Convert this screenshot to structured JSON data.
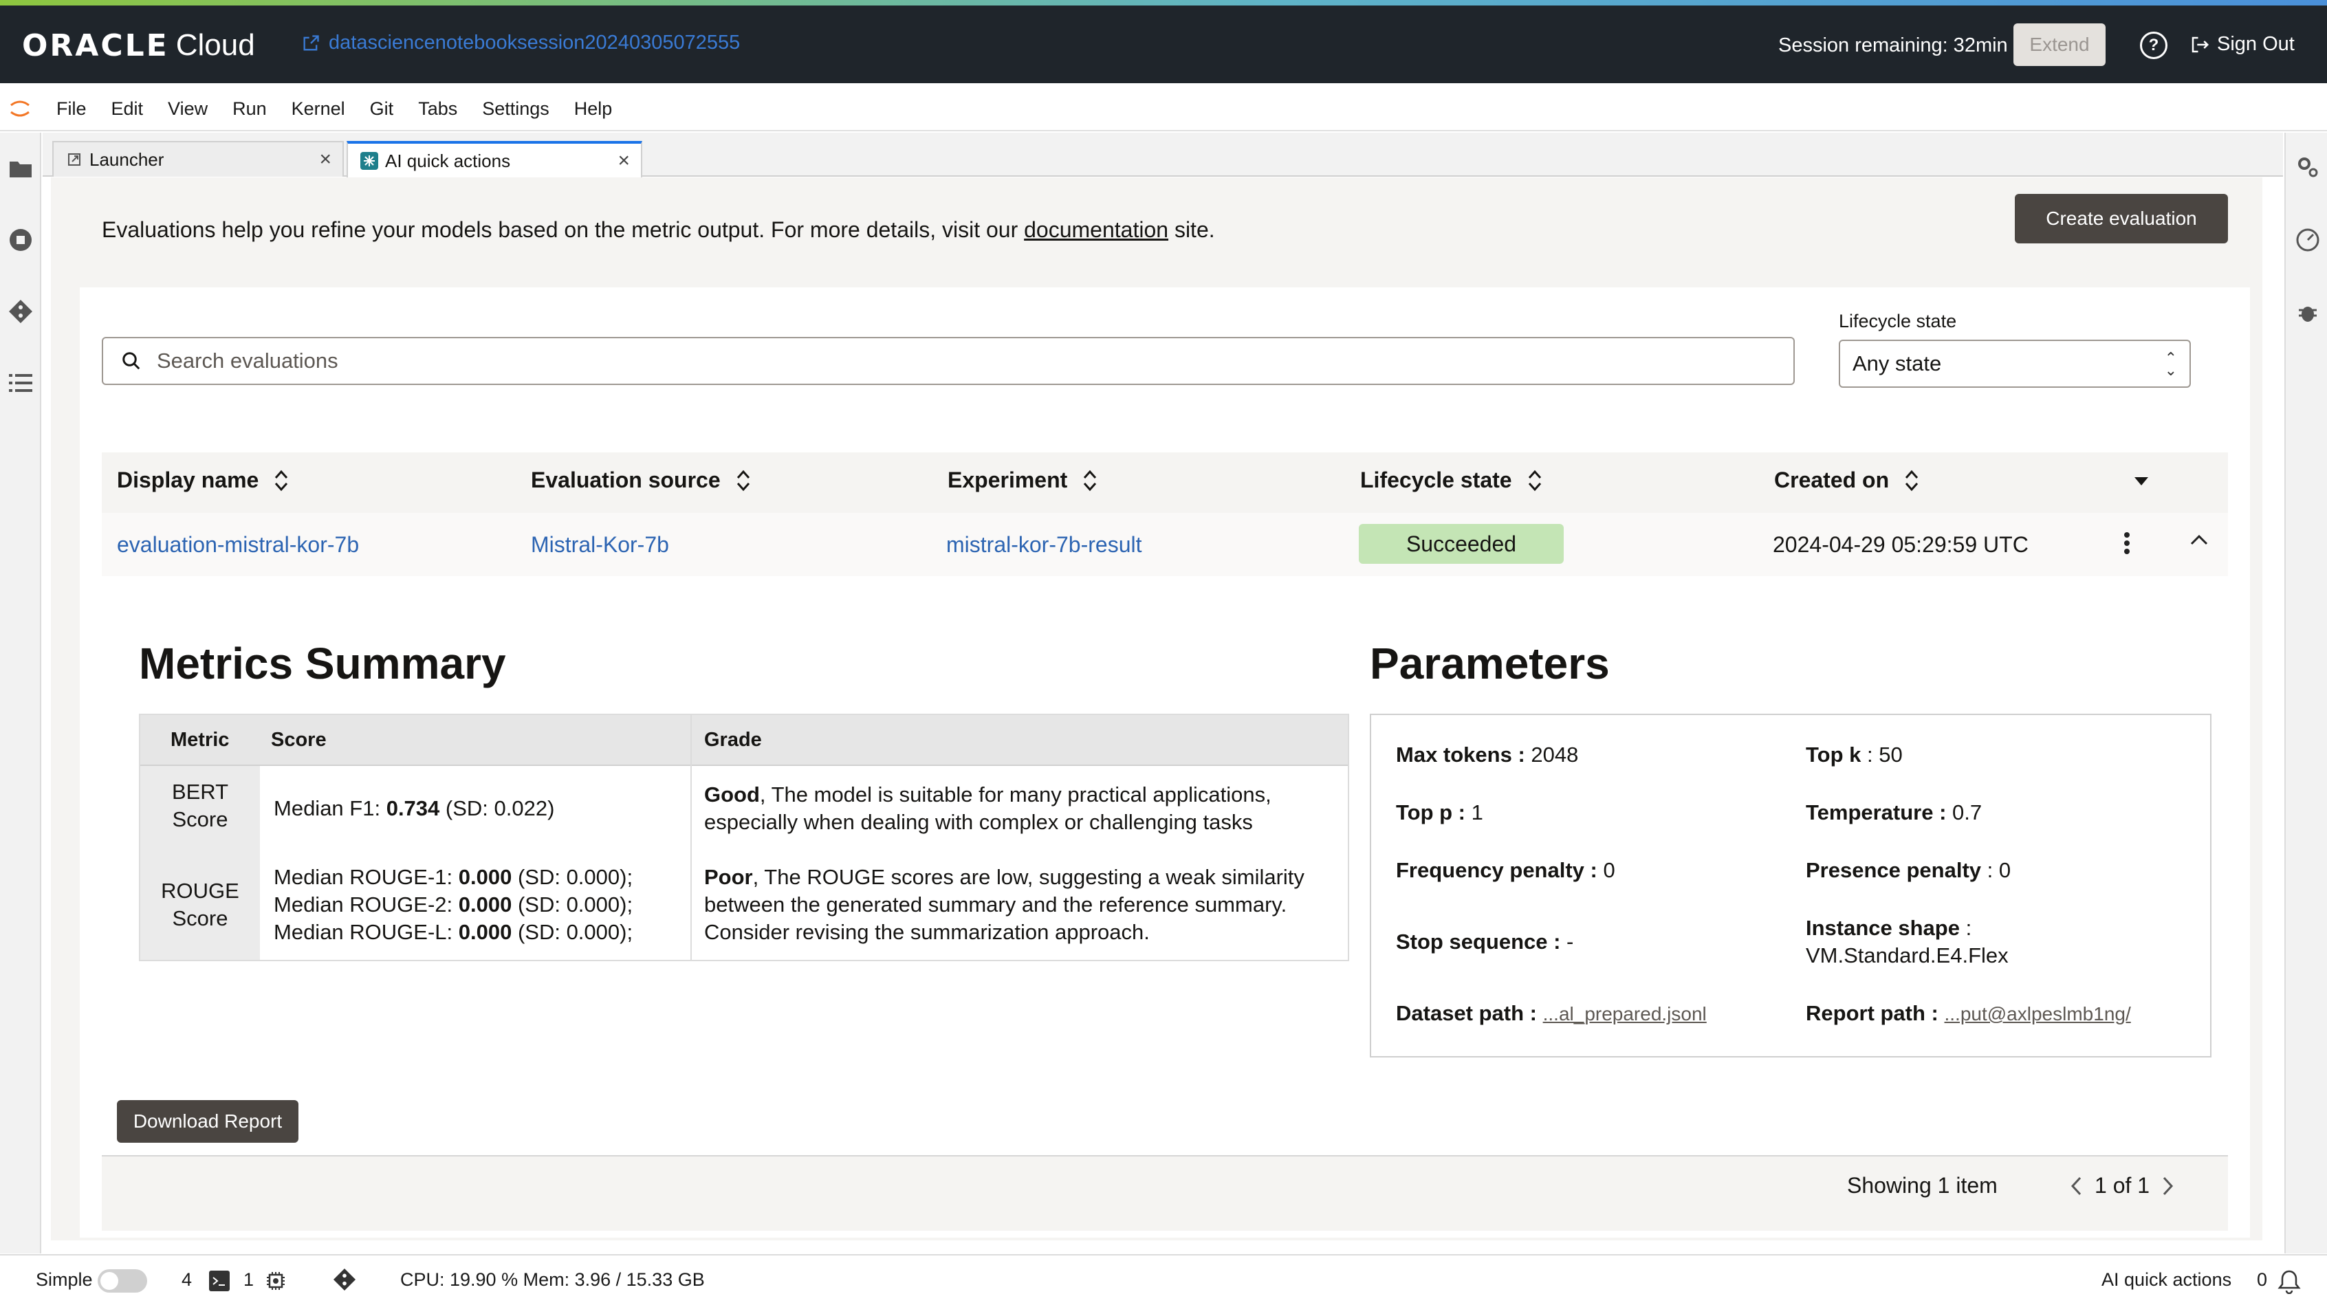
{
  "header": {
    "brand_oracle": "ORACLE",
    "brand_cloud": "Cloud",
    "notebook_link": "datasciencenotebooksession20240305072555",
    "session_remaining": "Session remaining: 32min",
    "extend_label": "Extend",
    "sign_out_label": "Sign Out"
  },
  "menu": [
    "File",
    "Edit",
    "View",
    "Run",
    "Kernel",
    "Git",
    "Tabs",
    "Settings",
    "Help"
  ],
  "tabs": [
    {
      "label": "Launcher",
      "close": "×"
    },
    {
      "label": "AI quick actions",
      "close": "×"
    }
  ],
  "intro": {
    "before": "Evaluations help you refine your models based on the metric output. For more details, visit our ",
    "link": "documentation",
    "after": " site."
  },
  "create_button": "Create evaluation",
  "search": {
    "placeholder": "Search evaluations"
  },
  "lifecycle_filter": {
    "label": "Lifecycle state",
    "value": "Any state"
  },
  "table": {
    "columns": [
      "Display name",
      "Evaluation source",
      "Experiment",
      "Lifecycle state",
      "Created on"
    ],
    "rows": [
      {
        "display_name": "evaluation-mistral-kor-7b",
        "evaluation_source": "Mistral-Kor-7b",
        "experiment": "mistral-kor-7b-result",
        "lifecycle_state": "Succeeded",
        "created_on": "2024-04-29 05:29:59 UTC"
      }
    ]
  },
  "metrics": {
    "title": "Metrics Summary",
    "headers": [
      "Metric",
      "Score",
      "Grade"
    ],
    "rows": [
      {
        "metric_line1": "BERT",
        "metric_line2": "Score",
        "score_prefix": "Median F1: ",
        "score_bold": "0.734",
        "score_suffix": " (SD: 0.022)",
        "grade_bold": "Good",
        "grade_line1": ", The model is suitable for many practical applications,",
        "grade_line2": "especially when dealing with complex or challenging tasks"
      },
      {
        "metric_line1": "ROUGE",
        "metric_line2": "Score",
        "score_lines": [
          {
            "prefix": "Median ROUGE-1: ",
            "bold": "0.000",
            "suffix": " (SD: 0.000);"
          },
          {
            "prefix": "Median ROUGE-2: ",
            "bold": "0.000",
            "suffix": " (SD: 0.000);"
          },
          {
            "prefix": "Median ROUGE-L: ",
            "bold": "0.000",
            "suffix": " (SD: 0.000);"
          }
        ],
        "grade_bold": "Poor",
        "grade_line1": ", The ROUGE scores are low, suggesting a weak similarity",
        "grade_line2": "between the generated summary and the reference summary.",
        "grade_line3": "Consider revising the summarization approach."
      }
    ]
  },
  "parameters": {
    "title": "Parameters",
    "max_tokens": {
      "key": "Max tokens :",
      "value": " 2048"
    },
    "top_k": {
      "key": "Top k",
      "value": " : 50"
    },
    "top_p": {
      "key": "Top p :",
      "value": " 1"
    },
    "temperature": {
      "key": "Temperature :",
      "value": " 0.7"
    },
    "frequency_penalty": {
      "key": "Frequency penalty :",
      "value": " 0"
    },
    "presence_penalty": {
      "key": "Presence penalty",
      "value": " : 0"
    },
    "stop_sequence": {
      "key": "Stop sequence :",
      "value": " -"
    },
    "instance_shape": {
      "key": "Instance shape",
      "value": " :",
      "value2": "VM.Standard.E4.Flex"
    },
    "dataset_path": {
      "key": "Dataset path :",
      "value": "...al_prepared.jsonl"
    },
    "report_path": {
      "key": "Report path :",
      "value": "...put@axlpeslmb1ng/"
    }
  },
  "download_button": "Download Report",
  "footer": {
    "showing": "Showing 1 item",
    "pager": "1 of 1"
  },
  "statusbar": {
    "mode": "Simple",
    "terminals": "4",
    "kernels": "1",
    "resources": "CPU: 19.90 % Mem: 3.96 / 15.33 GB",
    "active_tab": "AI quick actions",
    "notifications": "0"
  },
  "colors": {
    "accent_link": "#2c64b2",
    "badge_success": "#c4e5b5",
    "header_bg": "#1f252b",
    "button_dark": "#4a4541"
  }
}
